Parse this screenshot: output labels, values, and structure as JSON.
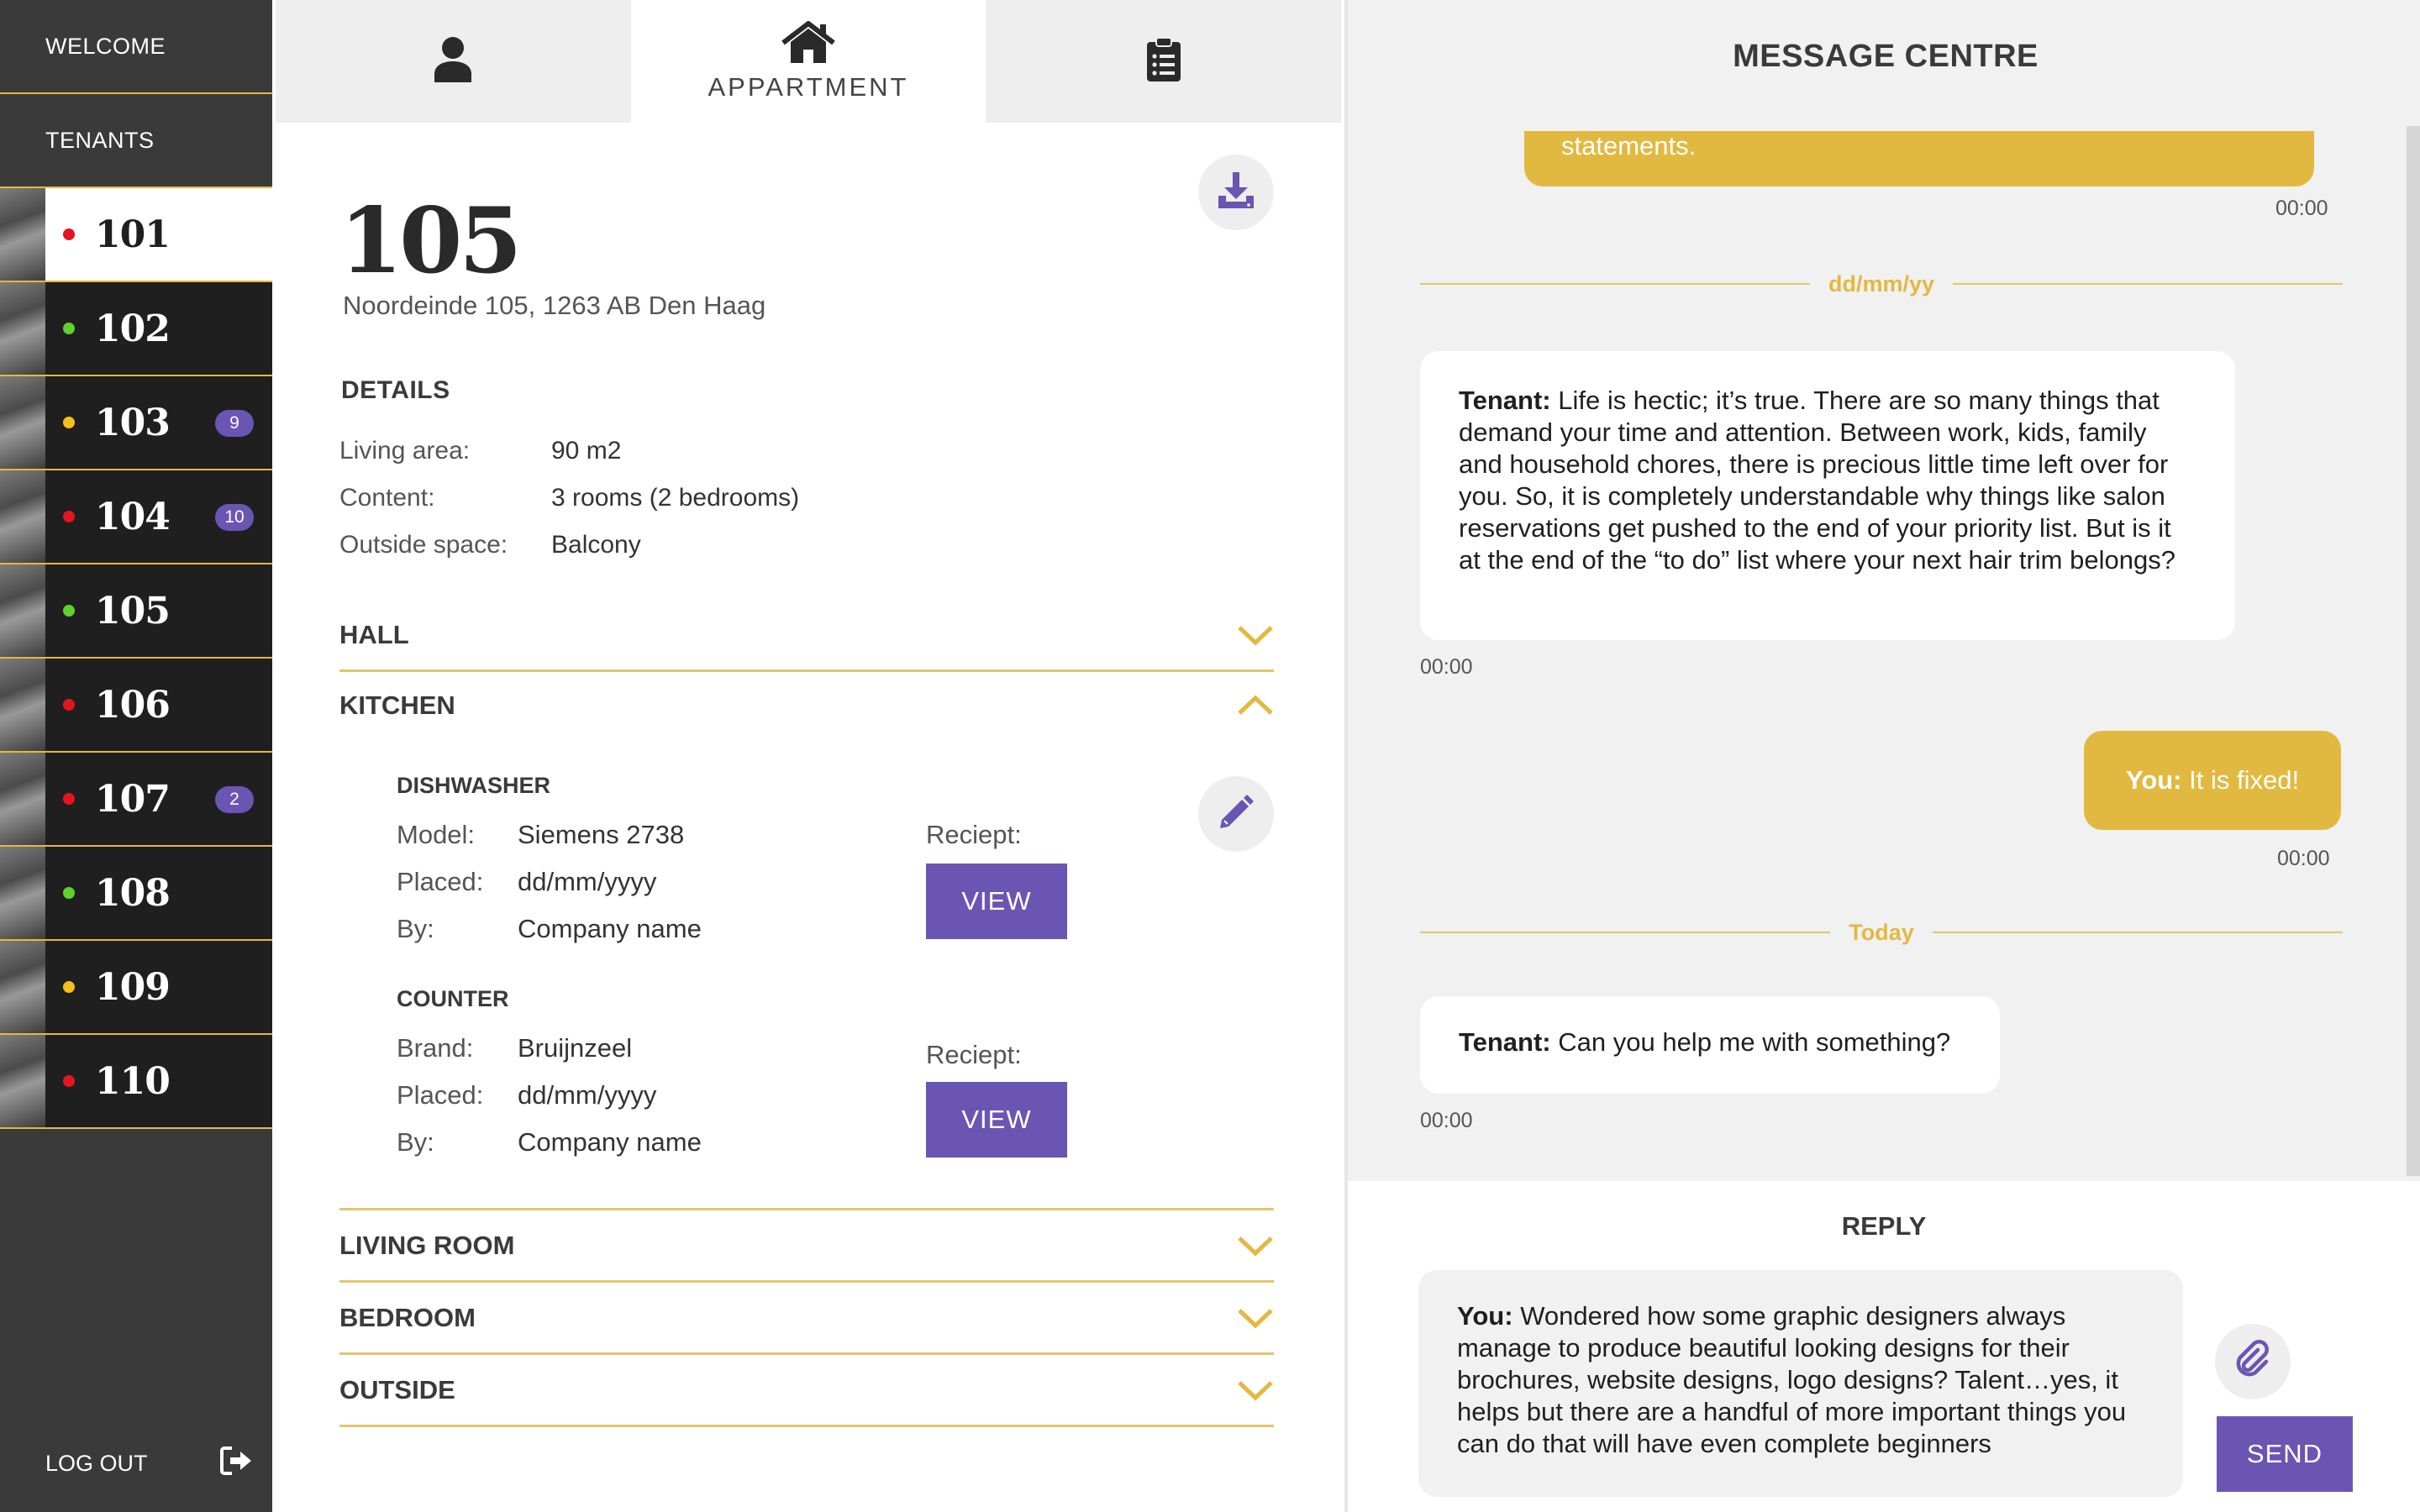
{
  "sidebar": {
    "nav": [
      {
        "label": "WELCOME"
      },
      {
        "label": "TENANTS"
      }
    ],
    "units": [
      {
        "number": "101",
        "status": "red",
        "badge": ""
      },
      {
        "number": "102",
        "status": "green",
        "badge": ""
      },
      {
        "number": "103",
        "status": "yellow",
        "badge": "9"
      },
      {
        "number": "104",
        "status": "red",
        "badge": "10"
      },
      {
        "number": "105",
        "status": "green",
        "badge": ""
      },
      {
        "number": "106",
        "status": "red",
        "badge": ""
      },
      {
        "number": "107",
        "status": "red",
        "badge": "2"
      },
      {
        "number": "108",
        "status": "green",
        "badge": ""
      },
      {
        "number": "109",
        "status": "yellow",
        "badge": ""
      },
      {
        "number": "110",
        "status": "red",
        "badge": ""
      }
    ],
    "logout_label": "LOG OUT",
    "status_colors": {
      "red": "#e3161f",
      "green": "#5fd12f",
      "yellow": "#f2c21b"
    }
  },
  "tabs": [
    {
      "icon": "user-icon",
      "label": ""
    },
    {
      "icon": "home-icon",
      "label": "APPARTMENT"
    },
    {
      "icon": "clipboard-icon",
      "label": ""
    }
  ],
  "apartment": {
    "number": "105",
    "address": "Noordeinde 105, 1263 AB Den Haag",
    "details_title": "DETAILS",
    "details": [
      {
        "label": "Living area:",
        "value": "90 m2"
      },
      {
        "label": "Content:",
        "value": "3 rooms (2 bedrooms)"
      },
      {
        "label": "Outside space:",
        "value": "Balcony"
      }
    ],
    "sections": {
      "hall": "HALL",
      "kitchen": "KITCHEN",
      "living_room": "LIVING ROOM",
      "bedroom": "BEDROOM",
      "outside": "OUTSIDE"
    },
    "kitchen_items": [
      {
        "title": "DISHWASHER",
        "rows": [
          {
            "label": "Model:",
            "value": "Siemens 2738"
          },
          {
            "label": "Placed:",
            "value": "dd/mm/yyyy"
          },
          {
            "label": "By:",
            "value": "Company name"
          }
        ],
        "receipt_label": "Reciept:",
        "view_label": "VIEW"
      },
      {
        "title": "COUNTER",
        "rows": [
          {
            "label": "Brand:",
            "value": "Bruijnzeel"
          },
          {
            "label": "Placed:",
            "value": "dd/mm/yyyy"
          },
          {
            "label": "By:",
            "value": "Company name"
          }
        ],
        "receipt_label": "Reciept:",
        "view_label": "VIEW"
      }
    ]
  },
  "messages": {
    "title": "MESSAGE CENTRE",
    "partial_text": "statements.",
    "partial_time": "00:00",
    "date_sep_1": "dd/mm/yy",
    "msg1_sender": "Tenant:",
    "msg1_text": " Life is hectic; it’s true. There are so many things that demand your time and attention. Between work, kids, family and household chores, there is precious little time left over for you. So, it is completely understandable why things like salon reservations get pushed to the end of your priority list. But is it at the end of the “to do” list where your next hair trim belongs?",
    "msg1_time": "00:00",
    "msg2_sender": "You:",
    "msg2_text": " It is fixed!",
    "msg2_time": "00:00",
    "date_sep_2": "Today",
    "msg3_sender": "Tenant:",
    "msg3_text": " Can you help me with something?",
    "msg3_time": "00:00",
    "reply_title": "REPLY",
    "reply_sender": "You:",
    "reply_text": " Wondered how some graphic designers always manage to produce beautiful looking designs for their brochures, website designs, logo designs? Talent…yes, it helps but there are a handful of more important things you can do that will have even complete beginners",
    "send_label": "SEND"
  },
  "colors": {
    "accent_gold": "#e2b940",
    "accent_purple": "#6a55b3",
    "sidebar_dark": "#1f1f1f"
  }
}
